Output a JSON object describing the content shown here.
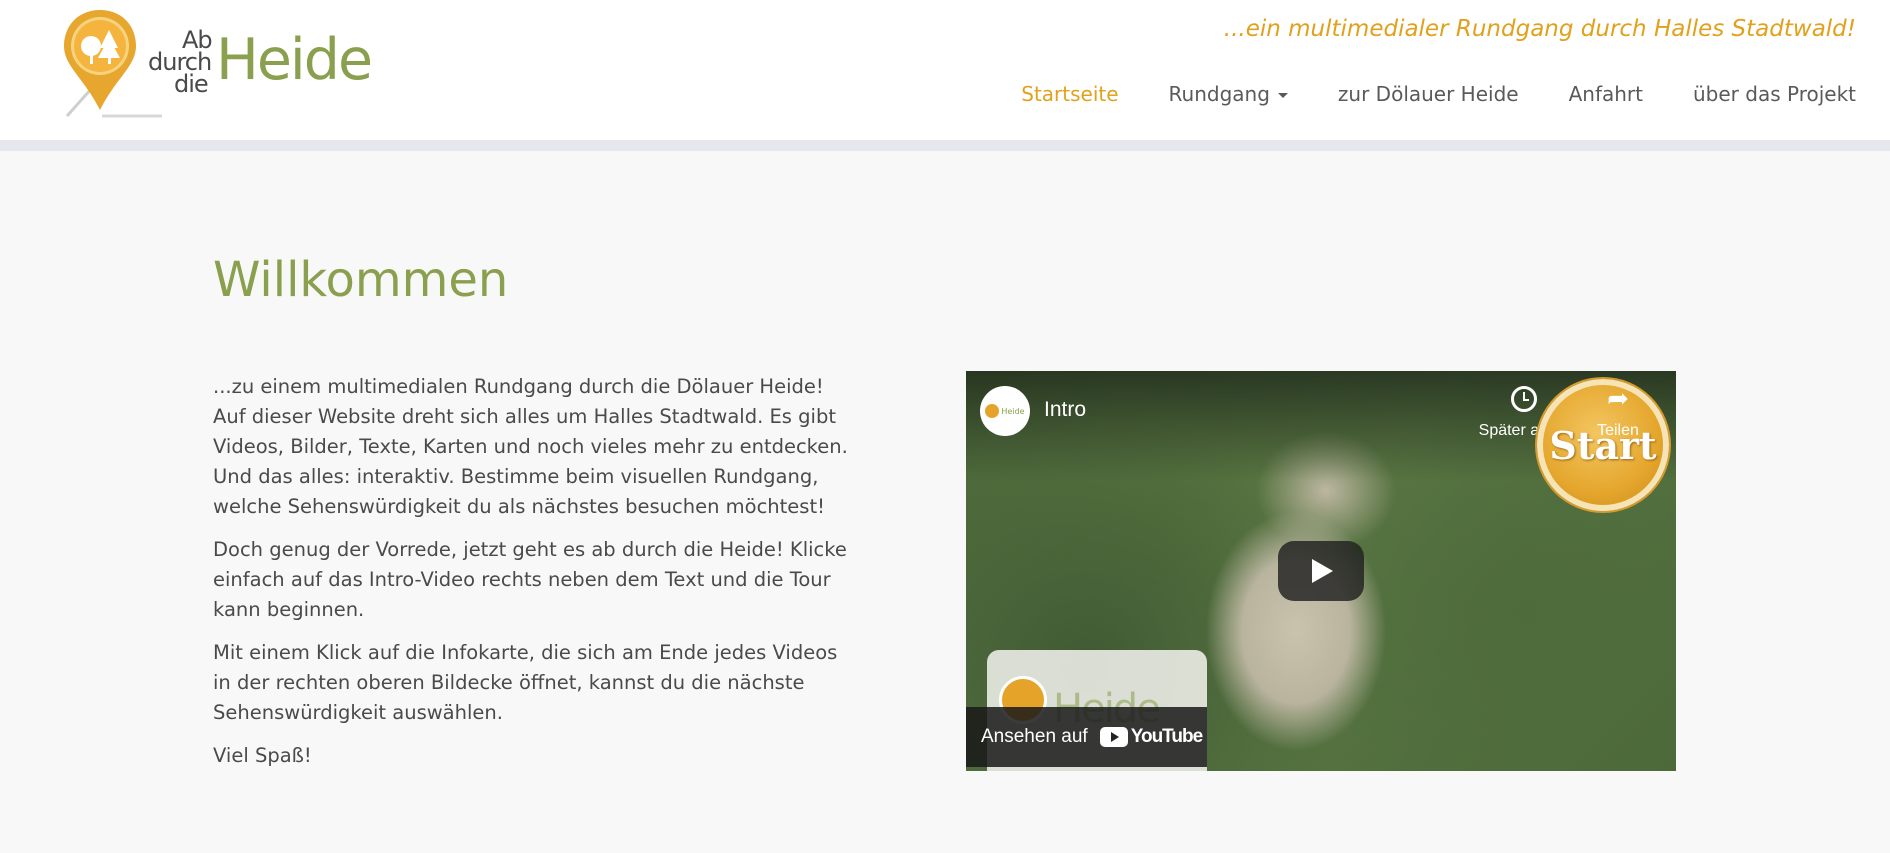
{
  "header": {
    "logo": {
      "ab": "Ab",
      "durch": "durch",
      "die": "die",
      "heide": "Heide"
    },
    "tagline": "...ein multimedialer Rundgang durch Halles Stadtwald!",
    "nav": [
      {
        "label": "Startseite",
        "active": true
      },
      {
        "label": "Rundgang",
        "has_dropdown": true
      },
      {
        "label": "zur Dölauer Heide"
      },
      {
        "label": "Anfahrt"
      },
      {
        "label": "über das Projekt"
      }
    ]
  },
  "main": {
    "title": "Willkommen",
    "paragraphs": [
      "...zu einem multimedialen Rundgang durch die Dölauer Heide! Auf dieser Website dreht sich alles um Halles Stadtwald. Es gibt Videos, Bilder, Texte, Karten und noch vieles mehr zu entdecken. Und das alles: interaktiv. Bestimme beim visuellen Rundgang, welche Sehenswürdigkeit du als nächstes besuchen möchtest!",
      "Doch genug der Vorrede, jetzt geht es ab durch die Heide! Klicke einfach auf das Intro-Video rechts neben dem Text und die Tour kann beginnen.",
      "Mit einem Klick auf die Infokarte, die sich am Ende jedes Videos in der rechten oberen Bildecke öffnet, kannst du die nächste Sehenswürdigkeit auswählen.",
      "Viel Spaß!"
    ]
  },
  "video": {
    "title": "Intro",
    "watch_later": "Später ans...",
    "share": "Teilen",
    "start_badge": "Start",
    "watch_on": "Ansehen auf",
    "youtube": "YouTube",
    "endcard_text": "Heide",
    "avatar_mini": "Heide"
  },
  "colors": {
    "brand_green": "#8aa04e",
    "accent_orange": "#e1a11c",
    "background": "#f8f8f8"
  }
}
